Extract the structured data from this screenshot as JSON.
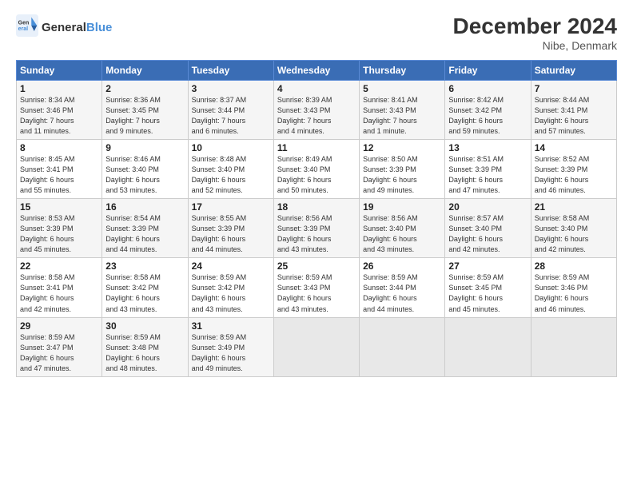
{
  "header": {
    "logo_general": "General",
    "logo_blue": "Blue",
    "title": "December 2024",
    "subtitle": "Nibe, Denmark"
  },
  "days_of_week": [
    "Sunday",
    "Monday",
    "Tuesday",
    "Wednesday",
    "Thursday",
    "Friday",
    "Saturday"
  ],
  "weeks": [
    [
      {
        "day": "1",
        "info": "Sunrise: 8:34 AM\nSunset: 3:46 PM\nDaylight: 7 hours\nand 11 minutes."
      },
      {
        "day": "2",
        "info": "Sunrise: 8:36 AM\nSunset: 3:45 PM\nDaylight: 7 hours\nand 9 minutes."
      },
      {
        "day": "3",
        "info": "Sunrise: 8:37 AM\nSunset: 3:44 PM\nDaylight: 7 hours\nand 6 minutes."
      },
      {
        "day": "4",
        "info": "Sunrise: 8:39 AM\nSunset: 3:43 PM\nDaylight: 7 hours\nand 4 minutes."
      },
      {
        "day": "5",
        "info": "Sunrise: 8:41 AM\nSunset: 3:43 PM\nDaylight: 7 hours\nand 1 minute."
      },
      {
        "day": "6",
        "info": "Sunrise: 8:42 AM\nSunset: 3:42 PM\nDaylight: 6 hours\nand 59 minutes."
      },
      {
        "day": "7",
        "info": "Sunrise: 8:44 AM\nSunset: 3:41 PM\nDaylight: 6 hours\nand 57 minutes."
      }
    ],
    [
      {
        "day": "8",
        "info": "Sunrise: 8:45 AM\nSunset: 3:41 PM\nDaylight: 6 hours\nand 55 minutes."
      },
      {
        "day": "9",
        "info": "Sunrise: 8:46 AM\nSunset: 3:40 PM\nDaylight: 6 hours\nand 53 minutes."
      },
      {
        "day": "10",
        "info": "Sunrise: 8:48 AM\nSunset: 3:40 PM\nDaylight: 6 hours\nand 52 minutes."
      },
      {
        "day": "11",
        "info": "Sunrise: 8:49 AM\nSunset: 3:40 PM\nDaylight: 6 hours\nand 50 minutes."
      },
      {
        "day": "12",
        "info": "Sunrise: 8:50 AM\nSunset: 3:39 PM\nDaylight: 6 hours\nand 49 minutes."
      },
      {
        "day": "13",
        "info": "Sunrise: 8:51 AM\nSunset: 3:39 PM\nDaylight: 6 hours\nand 47 minutes."
      },
      {
        "day": "14",
        "info": "Sunrise: 8:52 AM\nSunset: 3:39 PM\nDaylight: 6 hours\nand 46 minutes."
      }
    ],
    [
      {
        "day": "15",
        "info": "Sunrise: 8:53 AM\nSunset: 3:39 PM\nDaylight: 6 hours\nand 45 minutes."
      },
      {
        "day": "16",
        "info": "Sunrise: 8:54 AM\nSunset: 3:39 PM\nDaylight: 6 hours\nand 44 minutes."
      },
      {
        "day": "17",
        "info": "Sunrise: 8:55 AM\nSunset: 3:39 PM\nDaylight: 6 hours\nand 44 minutes."
      },
      {
        "day": "18",
        "info": "Sunrise: 8:56 AM\nSunset: 3:39 PM\nDaylight: 6 hours\nand 43 minutes."
      },
      {
        "day": "19",
        "info": "Sunrise: 8:56 AM\nSunset: 3:40 PM\nDaylight: 6 hours\nand 43 minutes."
      },
      {
        "day": "20",
        "info": "Sunrise: 8:57 AM\nSunset: 3:40 PM\nDaylight: 6 hours\nand 42 minutes."
      },
      {
        "day": "21",
        "info": "Sunrise: 8:58 AM\nSunset: 3:40 PM\nDaylight: 6 hours\nand 42 minutes."
      }
    ],
    [
      {
        "day": "22",
        "info": "Sunrise: 8:58 AM\nSunset: 3:41 PM\nDaylight: 6 hours\nand 42 minutes."
      },
      {
        "day": "23",
        "info": "Sunrise: 8:58 AM\nSunset: 3:42 PM\nDaylight: 6 hours\nand 43 minutes."
      },
      {
        "day": "24",
        "info": "Sunrise: 8:59 AM\nSunset: 3:42 PM\nDaylight: 6 hours\nand 43 minutes."
      },
      {
        "day": "25",
        "info": "Sunrise: 8:59 AM\nSunset: 3:43 PM\nDaylight: 6 hours\nand 43 minutes."
      },
      {
        "day": "26",
        "info": "Sunrise: 8:59 AM\nSunset: 3:44 PM\nDaylight: 6 hours\nand 44 minutes."
      },
      {
        "day": "27",
        "info": "Sunrise: 8:59 AM\nSunset: 3:45 PM\nDaylight: 6 hours\nand 45 minutes."
      },
      {
        "day": "28",
        "info": "Sunrise: 8:59 AM\nSunset: 3:46 PM\nDaylight: 6 hours\nand 46 minutes."
      }
    ],
    [
      {
        "day": "29",
        "info": "Sunrise: 8:59 AM\nSunset: 3:47 PM\nDaylight: 6 hours\nand 47 minutes."
      },
      {
        "day": "30",
        "info": "Sunrise: 8:59 AM\nSunset: 3:48 PM\nDaylight: 6 hours\nand 48 minutes."
      },
      {
        "day": "31",
        "info": "Sunrise: 8:59 AM\nSunset: 3:49 PM\nDaylight: 6 hours\nand 49 minutes."
      },
      {
        "day": "",
        "info": ""
      },
      {
        "day": "",
        "info": ""
      },
      {
        "day": "",
        "info": ""
      },
      {
        "day": "",
        "info": ""
      }
    ]
  ]
}
